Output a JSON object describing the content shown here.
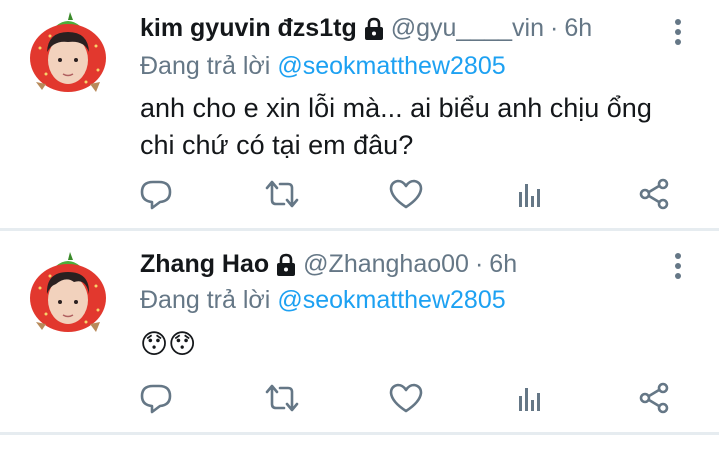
{
  "tweets": [
    {
      "display_name": "kim gyuvin đzs1tg",
      "handle": "@gyu____vin",
      "separator": "·",
      "time": "6h",
      "reply_prefix": "Đang trả lời",
      "reply_to": "@seokmatthew2805",
      "text_line1": "anh cho e xin lỗi mà... ai biểu anh chịu ổng",
      "text_line2": "chi chứ có tại em đâu?",
      "protected_icon": "lock-icon",
      "avatar": "strawberry-boy-avatar"
    },
    {
      "display_name": "Zhang Hao",
      "handle": "@Zhanghao00",
      "separator": "·",
      "time": "6h",
      "reply_prefix": "Đang trả lời",
      "reply_to": "@seokmatthew2805",
      "text": "😯😯",
      "protected_icon": "lock-icon",
      "avatar": "strawberry-boy-avatar"
    }
  ],
  "actions": [
    "reply-icon",
    "retweet-icon",
    "like-icon",
    "analytics-icon",
    "share-icon"
  ],
  "colors": {
    "text": "#14171a",
    "secondary": "#657786",
    "link": "#1da1f2",
    "divider": "#e6ecf0",
    "icon": "#657786"
  }
}
